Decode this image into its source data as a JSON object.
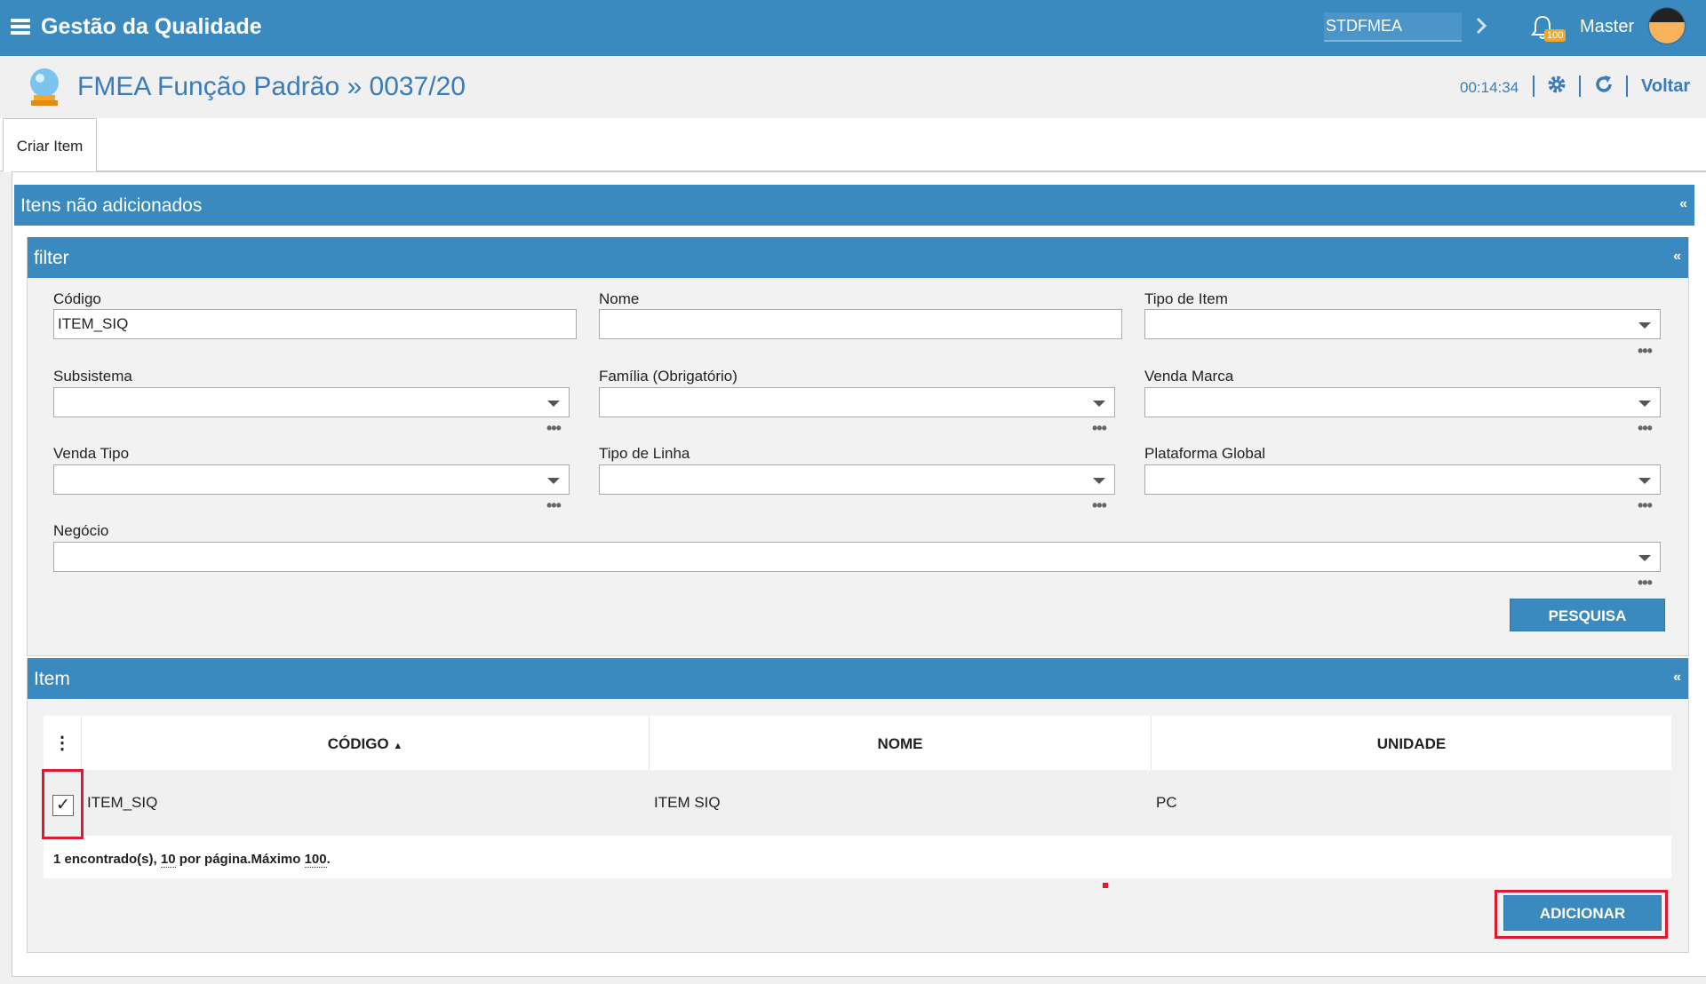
{
  "topbar": {
    "app_title": "Gestão da Qualidade",
    "module": "STDFMEA",
    "notifications_count": "100",
    "user_name": "Master"
  },
  "page": {
    "title": "FMEA Função Padrão » 0037/20",
    "timer": "00:14:34",
    "back_label": "Voltar"
  },
  "tabs": [
    {
      "label": "Criar Item"
    }
  ],
  "section": {
    "title": "Itens não adicionados",
    "collapse_icon": "«"
  },
  "filter": {
    "title": "filter",
    "collapse_icon": "«",
    "fields": {
      "codigo": {
        "label": "Código",
        "value": "ITEM_SIQ"
      },
      "nome": {
        "label": "Nome",
        "value": ""
      },
      "tipo_item": {
        "label": "Tipo de Item"
      },
      "subsistema": {
        "label": "Subsistema"
      },
      "familia": {
        "label": "Família (Obrigatório)"
      },
      "venda_marca": {
        "label": "Venda Marca"
      },
      "venda_tipo": {
        "label": "Venda Tipo"
      },
      "tipo_linha": {
        "label": "Tipo de Linha"
      },
      "plataforma_global": {
        "label": "Plataforma Global"
      },
      "negocio": {
        "label": "Negócio"
      }
    },
    "more_icon": "•••",
    "search_button": "PESQUISA"
  },
  "item": {
    "title": "Item",
    "collapse_icon": "«",
    "columns_menu_icon": "⋮",
    "columns": [
      "CÓDIGO",
      "NOME",
      "UNIDADE"
    ],
    "sort_indicator": "▲",
    "rows": [
      {
        "checked": "✓",
        "codigo": "ITEM_SIQ",
        "nome": "ITEM SIQ",
        "unidade": "PC"
      }
    ],
    "footer": {
      "found": "1 encontrado(s), ",
      "per_page": "10",
      "per_page_text": " por página.Máximo ",
      "max": "100",
      "end": "."
    },
    "add_button": "ADICIONAR"
  },
  "colors": {
    "primary": "#3a8ac0",
    "title_blue": "#3a7cb8",
    "highlight": "#e0192e"
  }
}
